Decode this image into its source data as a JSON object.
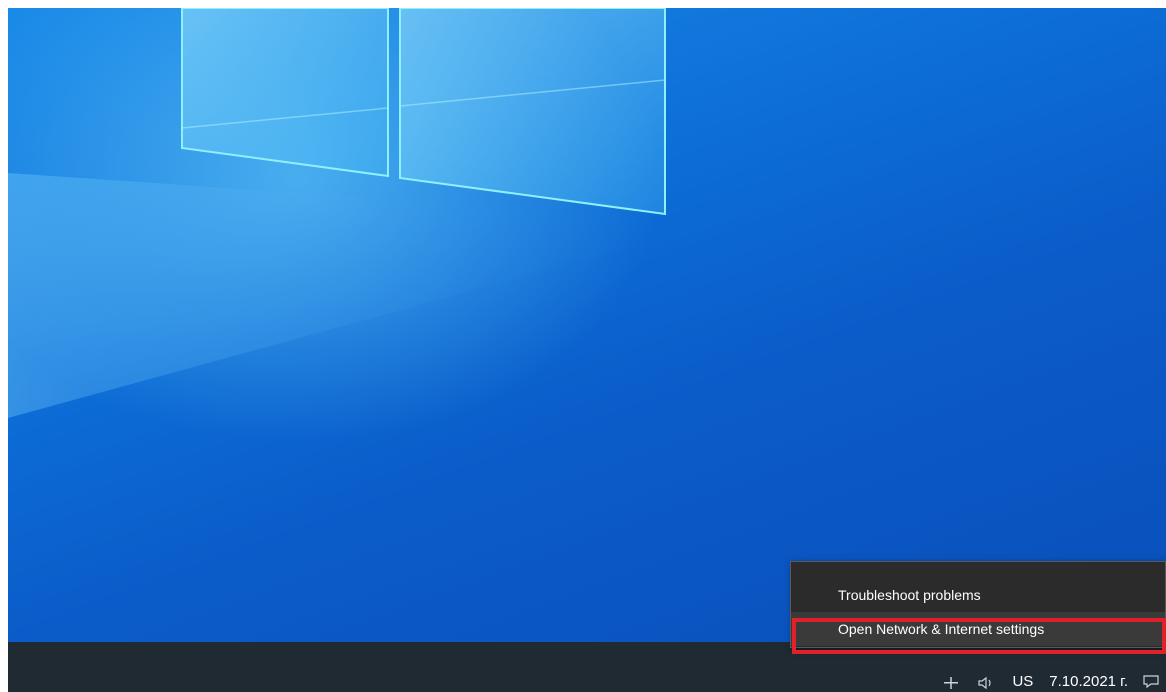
{
  "context_menu": {
    "items": [
      {
        "label": "Troubleshoot problems"
      },
      {
        "label": "Open Network & Internet settings"
      }
    ]
  },
  "tray": {
    "language": "US",
    "date": "7.10.2021 г.",
    "icons": [
      "network-icon",
      "volume-icon",
      "notification-icon"
    ]
  },
  "annotation": {
    "highlight_color": "#e0202a"
  }
}
